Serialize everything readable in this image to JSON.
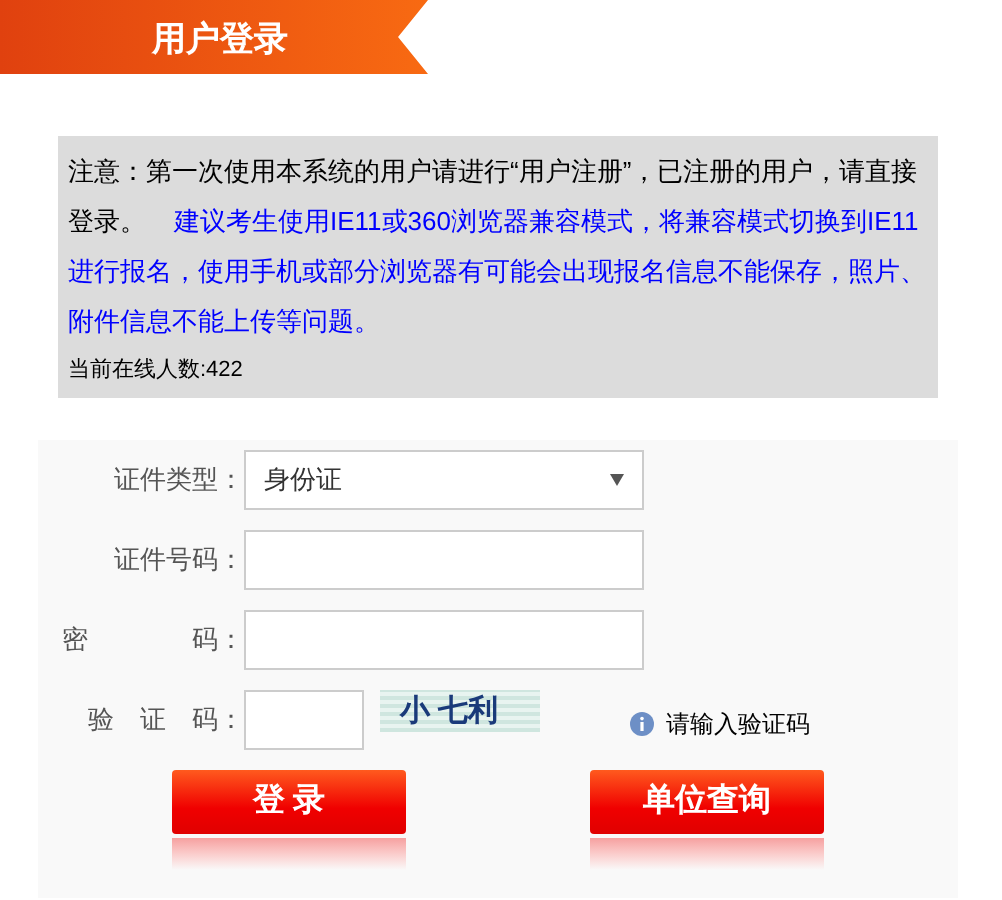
{
  "header": {
    "title": "用户登录"
  },
  "notice": {
    "text": "注意：第一次使用本系统的用户请进行“用户注册”，已注册的用户，请直接登录。",
    "advice": "建议考生使用IE11或360浏览器兼容模式，将兼容模式切换到IE11进行报名，使用手机或部分浏览器有可能会出现报名信息不能保存，照片、附件信息不能上传等问题。",
    "online": "当前在线人数:422"
  },
  "form": {
    "fields": [
      {
        "kind": "select",
        "label": "证件类型：",
        "value": "身份证"
      },
      {
        "kind": "text",
        "label": "证件号码："
      },
      {
        "kind": "password",
        "label": "密　　　　码："
      },
      {
        "kind": "captcha",
        "label": "验　证　码：",
        "captcha": "小 七利",
        "hint": "请输入验证码"
      }
    ],
    "buttons": [
      "登 录",
      "单位查询"
    ]
  }
}
